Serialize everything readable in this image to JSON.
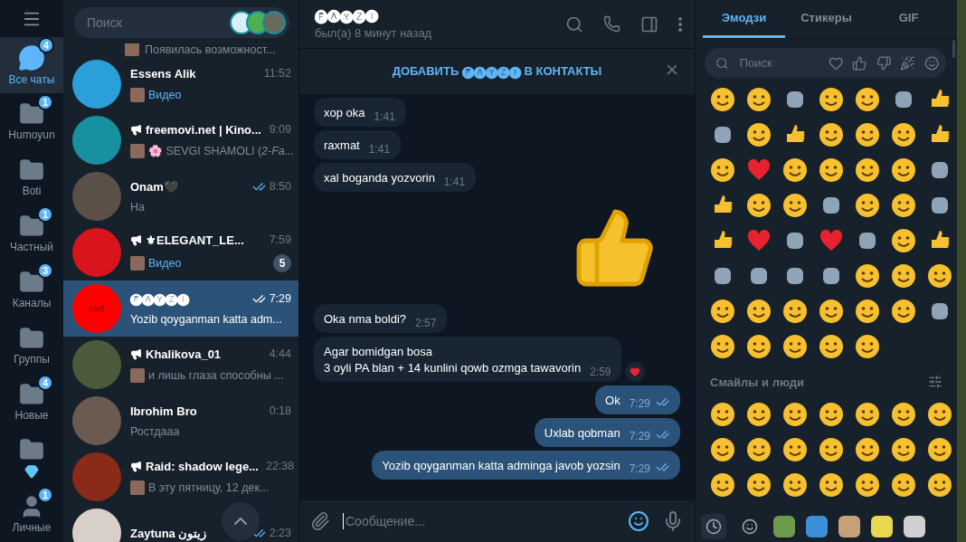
{
  "folders": [
    {
      "kind": "chats",
      "label": "Все чаты",
      "badge": "4",
      "selected": true
    },
    {
      "kind": "folder",
      "label": "Humoyun",
      "badge": "1",
      "selected": false
    },
    {
      "kind": "folder",
      "label": "Boti",
      "selected": false
    },
    {
      "kind": "folder",
      "label": "Частный",
      "badge": "1",
      "selected": false
    },
    {
      "kind": "folder",
      "label": "Каналы",
      "badge": "3",
      "selected": false
    },
    {
      "kind": "folder",
      "label": "Группы",
      "selected": false
    },
    {
      "kind": "folder",
      "label": "Новые",
      "badge": "4",
      "selected": false
    },
    {
      "kind": "gem",
      "selected": false
    },
    {
      "kind": "person",
      "label": "Личные",
      "badge": "1",
      "selected": false
    }
  ],
  "search": {
    "placeholder": "Поиск"
  },
  "chats": [
    {
      "kind": "partial",
      "preview": "Появилась возможност...",
      "thumbnail": true
    },
    {
      "kind": "chat",
      "name": "Essens Alik",
      "time": "11:52",
      "preview": "Видео",
      "media": true,
      "thumbnail": true,
      "selected": false
    },
    {
      "kind": "chat",
      "name": "freemovi.net | Kino...",
      "channel": true,
      "time": "9:09",
      "preview": "🌸 SEVGI SHAMOLI (*2-Fa...*",
      "thumbnail": true,
      "selected": false
    },
    {
      "kind": "chat",
      "name": "Onam🖤",
      "time": "8:50",
      "read": true,
      "preview": "На",
      "selected": false
    },
    {
      "kind": "chat",
      "name": "⚜ELEGANT_LE...",
      "channel": true,
      "time": "7:59",
      "preview": "Видео",
      "media": true,
      "thumbnail": true,
      "unread": "5",
      "selected": false
    },
    {
      "kind": "chat",
      "name": "🅕🅐🅨🅩🅘",
      "time": "7:29",
      "read": true,
      "preview": "Yozib qoyganman katta adm...",
      "avatar_text": "red",
      "selected": true
    },
    {
      "kind": "chat",
      "name": "Khalikova_01",
      "channel": true,
      "time": "4:44",
      "preview": "и лишь глаза способны ...",
      "thumbnail": true,
      "selected": false
    },
    {
      "kind": "chat",
      "name": "Ibrohim Bro",
      "time": "0:18",
      "preview": "Ростдааа",
      "selected": false
    },
    {
      "kind": "chat",
      "name": "Raid: shadow lege...",
      "channel": true,
      "time": "22:38",
      "preview": "В эту пятницу, 12 дек...",
      "thumbnail": true,
      "selected": false
    },
    {
      "kind": "chat",
      "name": "Zaytuna زيتون",
      "time": "2:23",
      "read": true,
      "selected": false
    }
  ],
  "chat": {
    "title": "🅕🅐🅨🅩🅘",
    "status": "был(а) 8 минут назад",
    "banner": "ДОБАВИТЬ 🅕🅐🅨🅩🅘 В КОНТАКТЫ"
  },
  "messages": [
    {
      "kind": "in",
      "text": "xop oka",
      "time": "1:41"
    },
    {
      "kind": "in",
      "text": "raxmat",
      "time": "1:41"
    },
    {
      "kind": "in",
      "text": "xal boganda yozvorin",
      "time": "1:41"
    },
    {
      "kind": "sticker"
    },
    {
      "kind": "in",
      "text": "Oka nma boldi?",
      "time": "2:57"
    },
    {
      "kind": "in",
      "text": "Agar bomidgan bosa\n3 oyli PA blan + 14 kunlini qowb ozmga tawavorin",
      "time": "2:59",
      "reaction": true
    },
    {
      "kind": "out",
      "text": "Ok",
      "time": "7:29",
      "read": true
    },
    {
      "kind": "out",
      "text": "Uxlab qobman",
      "time": "7:29",
      "read": true
    },
    {
      "kind": "out",
      "text": "Yozib qoyganman katta adminga javob yozsin",
      "time": "7:29",
      "read": true
    }
  ],
  "composer": {
    "placeholder": "Сообщение..."
  },
  "emoji_panel": {
    "tabs": [
      {
        "label": "Эмодзи",
        "selected": true
      },
      {
        "label": "Стикеры",
        "selected": false
      },
      {
        "label": "GIF",
        "selected": false
      }
    ],
    "search": {
      "placeholder": "Поиск"
    },
    "section": "Смайлы и люди"
  }
}
